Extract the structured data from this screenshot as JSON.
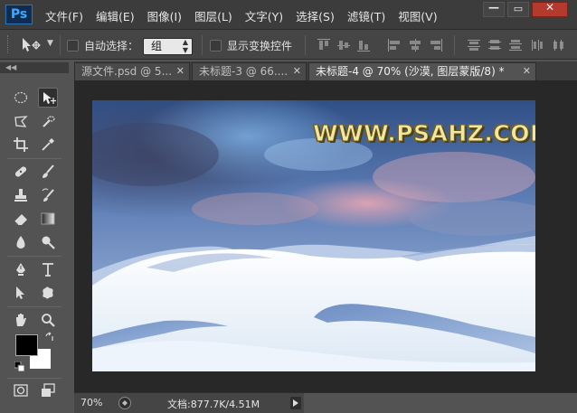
{
  "app": {
    "logo": "Ps",
    "menus": [
      "文件(F)",
      "编辑(E)",
      "图像(I)",
      "图层(L)",
      "文字(Y)",
      "选择(S)",
      "滤镜(T)",
      "视图(V)"
    ],
    "window_controls": [
      "minimize-icon",
      "restore-icon",
      "close-icon"
    ]
  },
  "options": {
    "auto_select_label": "自动选择：",
    "auto_select_value": "组",
    "show_transform_label": "显示变换控件"
  },
  "tabs": [
    {
      "label": "源文件.psd @ 5...",
      "active": false
    },
    {
      "label": "未标题-3 @ 66....",
      "active": false
    },
    {
      "label": "未标题-4 @ 70% (沙漠, 图层蒙版/8) *",
      "active": true
    }
  ],
  "document": {
    "watermark": "WWW.PSAHZ.COM"
  },
  "status": {
    "zoom": "70%",
    "doc_info": "文档:877.7K/4.51M"
  },
  "colors": {
    "foreground": "#000000",
    "background": "#ffffff",
    "accent": "#2d74b4"
  },
  "tools": [
    "elliptical-marquee-icon",
    "move-icon",
    "lasso-icon",
    "quick-selection-icon",
    "crop-icon",
    "eyedropper-icon",
    "healing-brush-icon",
    "brush-icon",
    "clone-stamp-icon",
    "history-brush-icon",
    "eraser-icon",
    "gradient-icon",
    "blur-icon",
    "dodge-icon",
    "pen-icon",
    "type-icon",
    "path-selection-icon",
    "custom-shape-icon",
    "hand-icon",
    "zoom-icon",
    "quick-mask-icon",
    "screen-mode-icon"
  ]
}
